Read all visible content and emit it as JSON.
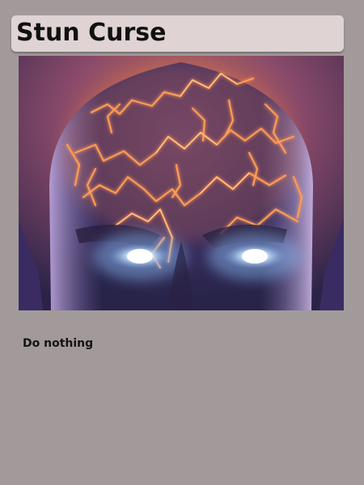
{
  "card": {
    "title": "Stun Curse",
    "description": "Do nothing",
    "art_icon": "glowing-brain-head-icon"
  },
  "colors": {
    "background": "#a29a9a",
    "title_bar": "#dfd3d3",
    "text": "#111111",
    "lightning": "#ff9a55",
    "eye_glow": "#cfe6ff"
  }
}
